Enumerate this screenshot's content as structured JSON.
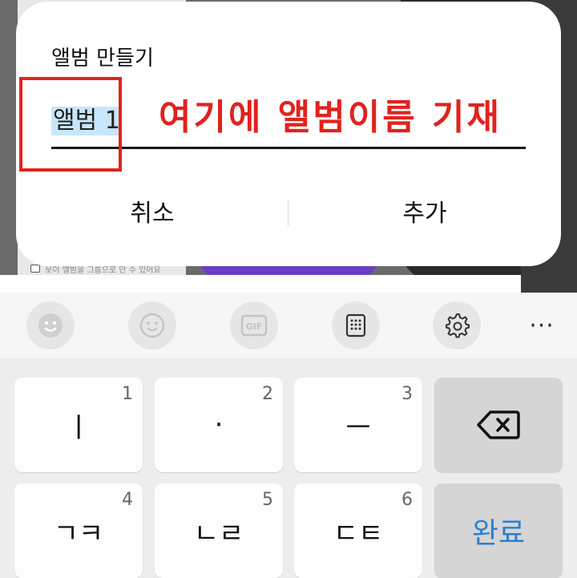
{
  "background": {
    "caption": "보이 앨범을 그룹으로 만 수 있어요"
  },
  "dialog": {
    "title": "앨범 만들기",
    "input_value": "앨범 1",
    "hint": "여기에 앨범이름 기재",
    "cancel_label": "취소",
    "add_label": "추가"
  },
  "keyboard": {
    "toolbar": [
      {
        "icon": "emoji-face-icon"
      },
      {
        "icon": "smiley-icon"
      },
      {
        "icon": "gif-icon",
        "label": "GIF"
      },
      {
        "icon": "keypad-icon"
      },
      {
        "icon": "gear-icon"
      },
      {
        "icon": "more-icon",
        "label": "···"
      }
    ],
    "keys": [
      {
        "label": "ㅣ",
        "num": "1"
      },
      {
        "label": "·",
        "num": "2"
      },
      {
        "label": "ㅡ",
        "num": "3"
      },
      {
        "label": "ㄱㅋ",
        "num": "4"
      },
      {
        "label": "ㄴㄹ",
        "num": "5"
      },
      {
        "label": "ㄷㅌ",
        "num": "6"
      }
    ],
    "done_label": "완료"
  },
  "colors": {
    "annotation_red": "#e1231e",
    "done_blue": "#2a7fd4",
    "selection_blue": "#c8e6fb"
  }
}
